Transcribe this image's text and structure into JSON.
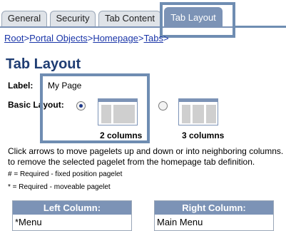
{
  "tabs": [
    {
      "label": "General"
    },
    {
      "label": "Security"
    },
    {
      "label": "Tab Content"
    },
    {
      "label": "Tab Layout",
      "active": true
    }
  ],
  "breadcrumb": {
    "items": [
      "Root",
      "Portal Objects",
      "Homepage",
      "Tabs"
    ],
    "separator": ">"
  },
  "page_title": "Tab Layout",
  "form": {
    "label_caption": "Label:",
    "label_value": "My Page",
    "basic_layout_caption": "Basic Layout:",
    "layout_options": [
      {
        "caption": "2 columns",
        "selected": true
      },
      {
        "caption": "3 columns",
        "selected": false
      }
    ]
  },
  "instructions": "Click arrows to move pagelets up and down or into neighboring columns. to remove the selected pagelet from the homepage tab definition.",
  "notes": [
    "# = Required - fixed position pagelet",
    "* = Required - moveable pagelet"
  ],
  "columns": {
    "left": {
      "header": "Left Column:",
      "items": [
        "*Menu"
      ]
    },
    "right": {
      "header": "Right Column:",
      "items": [
        "Main Menu"
      ]
    }
  },
  "colors": {
    "accent": "#7c93b6",
    "title": "#1f3d73",
    "link": "#1a35a8",
    "highlight": "#6f8db2"
  }
}
